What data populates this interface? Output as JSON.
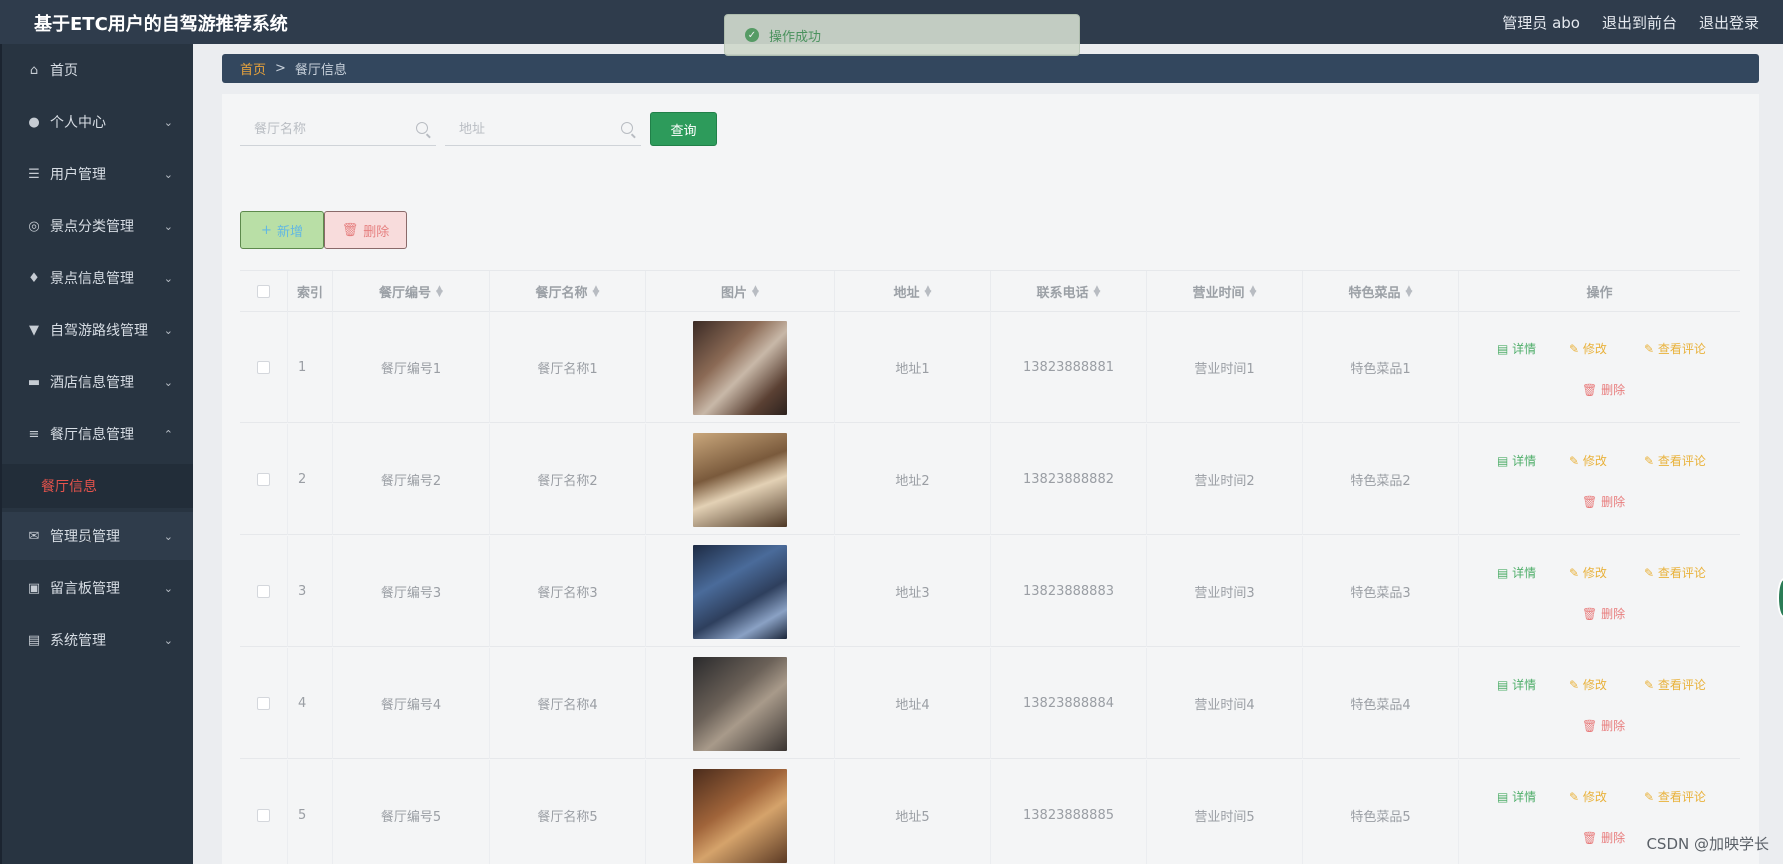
{
  "app": {
    "title": "基于ETC用户的自驾游推荐系统"
  },
  "header": {
    "user": "管理员 abo",
    "to_front": "退出到前台",
    "logout": "退出登录"
  },
  "toast": {
    "text": "操作成功"
  },
  "sidebar": {
    "items": [
      {
        "label": "首页",
        "icon": "home-icon"
      },
      {
        "label": "个人中心",
        "icon": "user-icon"
      },
      {
        "label": "用户管理",
        "icon": "list-icon"
      },
      {
        "label": "景点分类管理",
        "icon": "compass-icon"
      },
      {
        "label": "景点信息管理",
        "icon": "mic-icon"
      },
      {
        "label": "自驾游路线管理",
        "icon": "route-icon"
      },
      {
        "label": "酒店信息管理",
        "icon": "ticket-icon"
      },
      {
        "label": "餐厅信息管理",
        "icon": "sliders-icon"
      },
      {
        "label": "管理员管理",
        "icon": "mail-icon"
      },
      {
        "label": "留言板管理",
        "icon": "monitor-icon"
      },
      {
        "label": "系统管理",
        "icon": "clipboard-icon"
      }
    ],
    "active_sub": "餐厅信息"
  },
  "breadcrumb": {
    "home": "首页",
    "sep": ">",
    "current": "餐厅信息"
  },
  "search": {
    "name_placeholder": "餐厅名称",
    "addr_placeholder": "地址",
    "query": "查询"
  },
  "actions": {
    "add": "新增",
    "delete": "删除"
  },
  "table": {
    "headers": [
      "索引",
      "餐厅编号",
      "餐厅名称",
      "图片",
      "地址",
      "联系电话",
      "营业时间",
      "特色菜品",
      "操作"
    ],
    "rows": [
      {
        "idx": "1",
        "code": "餐厅编号1",
        "name": "餐厅名称1",
        "addr": "地址1",
        "phone": "13823888881",
        "hours": "营业时间1",
        "dish": "特色菜品1"
      },
      {
        "idx": "2",
        "code": "餐厅编号2",
        "name": "餐厅名称2",
        "addr": "地址2",
        "phone": "13823888882",
        "hours": "营业时间2",
        "dish": "特色菜品2"
      },
      {
        "idx": "3",
        "code": "餐厅编号3",
        "name": "餐厅名称3",
        "addr": "地址3",
        "phone": "13823888883",
        "hours": "营业时间3",
        "dish": "特色菜品3"
      },
      {
        "idx": "4",
        "code": "餐厅编号4",
        "name": "餐厅名称4",
        "addr": "地址4",
        "phone": "13823888884",
        "hours": "营业时间4",
        "dish": "特色菜品4"
      },
      {
        "idx": "5",
        "code": "餐厅编号5",
        "name": "餐厅名称5",
        "addr": "地址5",
        "phone": "13823888885",
        "hours": "营业时间5",
        "dish": "特色菜品5"
      }
    ],
    "ops": {
      "detail": "详情",
      "edit": "修改",
      "review": "查看评论",
      "delete": "删除"
    }
  },
  "watermark": "CSDN @加映学长"
}
